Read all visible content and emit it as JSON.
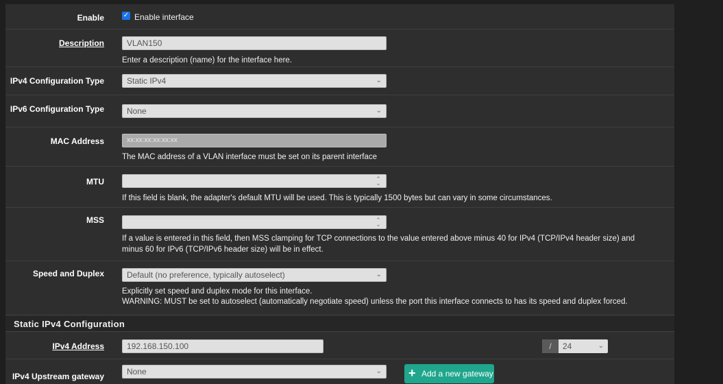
{
  "enable": {
    "label": "Enable",
    "checkbox_label": "Enable interface",
    "checked": true
  },
  "description": {
    "label": "Description",
    "value": "VLAN150",
    "help": "Enter a description (name) for the interface here."
  },
  "ipv4_type": {
    "label": "IPv4 Configuration Type",
    "value": "Static IPv4"
  },
  "ipv6_type": {
    "label": "IPv6 Configuration Type",
    "value": "None"
  },
  "mac": {
    "label": "MAC Address",
    "placeholder": "xx:xx:xx:xx:xx:xx",
    "help": "The MAC address of a VLAN interface must be set on its parent interface"
  },
  "mtu": {
    "label": "MTU",
    "value": "",
    "help": "If this field is blank, the adapter's default MTU will be used. This is typically 1500 bytes but can vary in some circumstances."
  },
  "mss": {
    "label": "MSS",
    "value": "",
    "help_line1": "If a value is entered in this field, then MSS clamping for TCP connections to the value entered above minus 40 for IPv4 (TCP/IPv4 header size) and",
    "help_line2": "minus 60 for IPv6 (TCP/IPv6 header size) will be in effect."
  },
  "speed": {
    "label": "Speed and Duplex",
    "value": "Default (no preference, typically autoselect)",
    "help_line1": "Explicitly set speed and duplex mode for this interface.",
    "help_line2": "WARNING: MUST be set to autoselect (automatically negotiate speed) unless the port this interface connects to has its speed and duplex forced."
  },
  "static_ipv4": {
    "section_title": "Static IPv4 Configuration",
    "address": {
      "label": "IPv4 Address",
      "value": "192.168.150.100",
      "slash": "/",
      "cidr": "24"
    },
    "gateway": {
      "label": "IPv4 Upstream gateway",
      "value": "None",
      "add_button": "Add a new gateway"
    }
  },
  "colors": {
    "accent": "#1a73e8",
    "button_green": "#1fa68d",
    "panel": "#2e2e2e"
  },
  "icons": {
    "checkbox": "check-icon",
    "dropdown": "chevron-down-icon",
    "spinner": "spinner-arrows-icon",
    "add": "plus-icon"
  }
}
